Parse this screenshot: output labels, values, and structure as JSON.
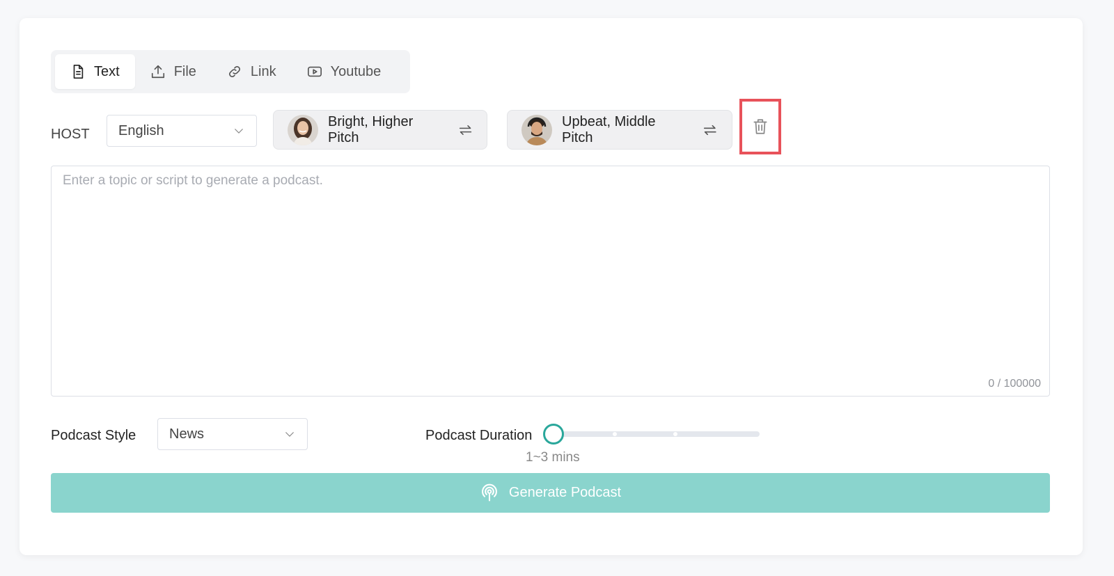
{
  "tabs": [
    {
      "label": "Text",
      "icon": "document-icon",
      "active": true
    },
    {
      "label": "File",
      "icon": "upload-icon",
      "active": false
    },
    {
      "label": "Link",
      "icon": "link-icon",
      "active": false
    },
    {
      "label": "Youtube",
      "icon": "youtube-icon",
      "active": false
    }
  ],
  "host": {
    "label": "HOST",
    "language": "English",
    "voices": [
      {
        "label": "Bright, Higher Pitch"
      },
      {
        "label": "Upbeat, Middle Pitch"
      }
    ]
  },
  "editor": {
    "placeholder": "Enter a topic or script to generate a podcast.",
    "counter": "0 / 100000"
  },
  "settings": {
    "style_label": "Podcast Style",
    "style_value": "News",
    "duration_label": "Podcast Duration",
    "duration_value": "1~3 mins"
  },
  "generate": {
    "label": "Generate Podcast"
  },
  "colors": {
    "accent": "#2aa79b",
    "button": "#8ad4cd",
    "highlight_box": "#e8525a"
  }
}
